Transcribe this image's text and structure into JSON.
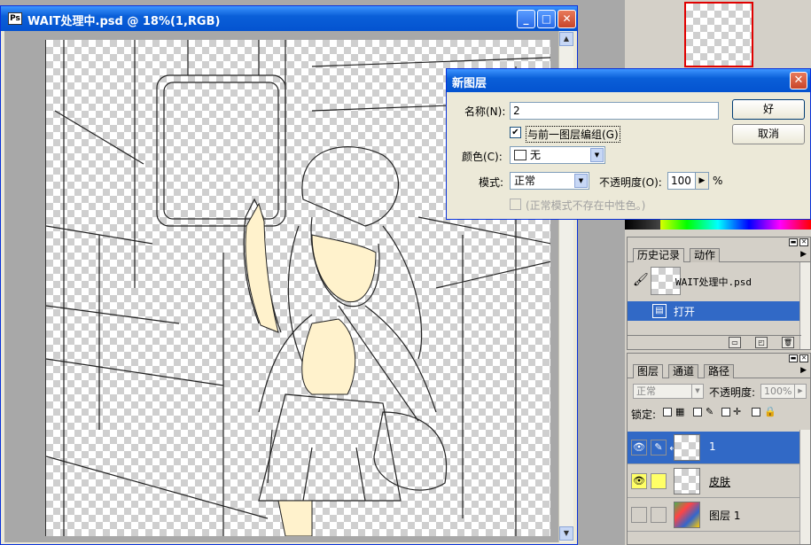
{
  "document": {
    "title": "WAIT处理中.psd @ 18%(1,RGB)",
    "app_icon": "photoshop-doc-icon",
    "minimize_glyph": "_",
    "maximize_glyph": "□",
    "close_glyph": "✕"
  },
  "dialog": {
    "title": "新图层",
    "name_label": "名称(N):",
    "name_value": "2",
    "group_checkbox_label": "与前一图层编组(G)",
    "group_checked": true,
    "color_label": "颜色(C):",
    "color_value": "无",
    "mode_label": "模式:",
    "mode_value": "正常",
    "opacity_label": "不透明度(O):",
    "opacity_value": "100",
    "opacity_unit": "%",
    "neutral_label": "(正常模式不存在中性色。)",
    "ok_label": "好",
    "cancel_label": "取消"
  },
  "history_panel": {
    "tabs": [
      "历史记录",
      "动作"
    ],
    "snapshot_label": "WAIT处理中.psd",
    "items": [
      "打开"
    ]
  },
  "layers_panel": {
    "tabs": [
      "图层",
      "通道",
      "路径"
    ],
    "blend_mode": "正常",
    "opacity_label": "不透明度:",
    "opacity_value": "100%",
    "lock_label": "锁定:",
    "layers": [
      {
        "name": "1",
        "selected": true,
        "visible": true
      },
      {
        "name": "皮肤",
        "selected": false,
        "visible": true
      },
      {
        "name": "图层 1",
        "selected": false,
        "visible": false
      }
    ]
  },
  "colors": {
    "titlebar": "#0a5fd8",
    "selection": "#3169c6",
    "highlight_yellow": "#ffff66",
    "skin": "#fff2cc"
  }
}
